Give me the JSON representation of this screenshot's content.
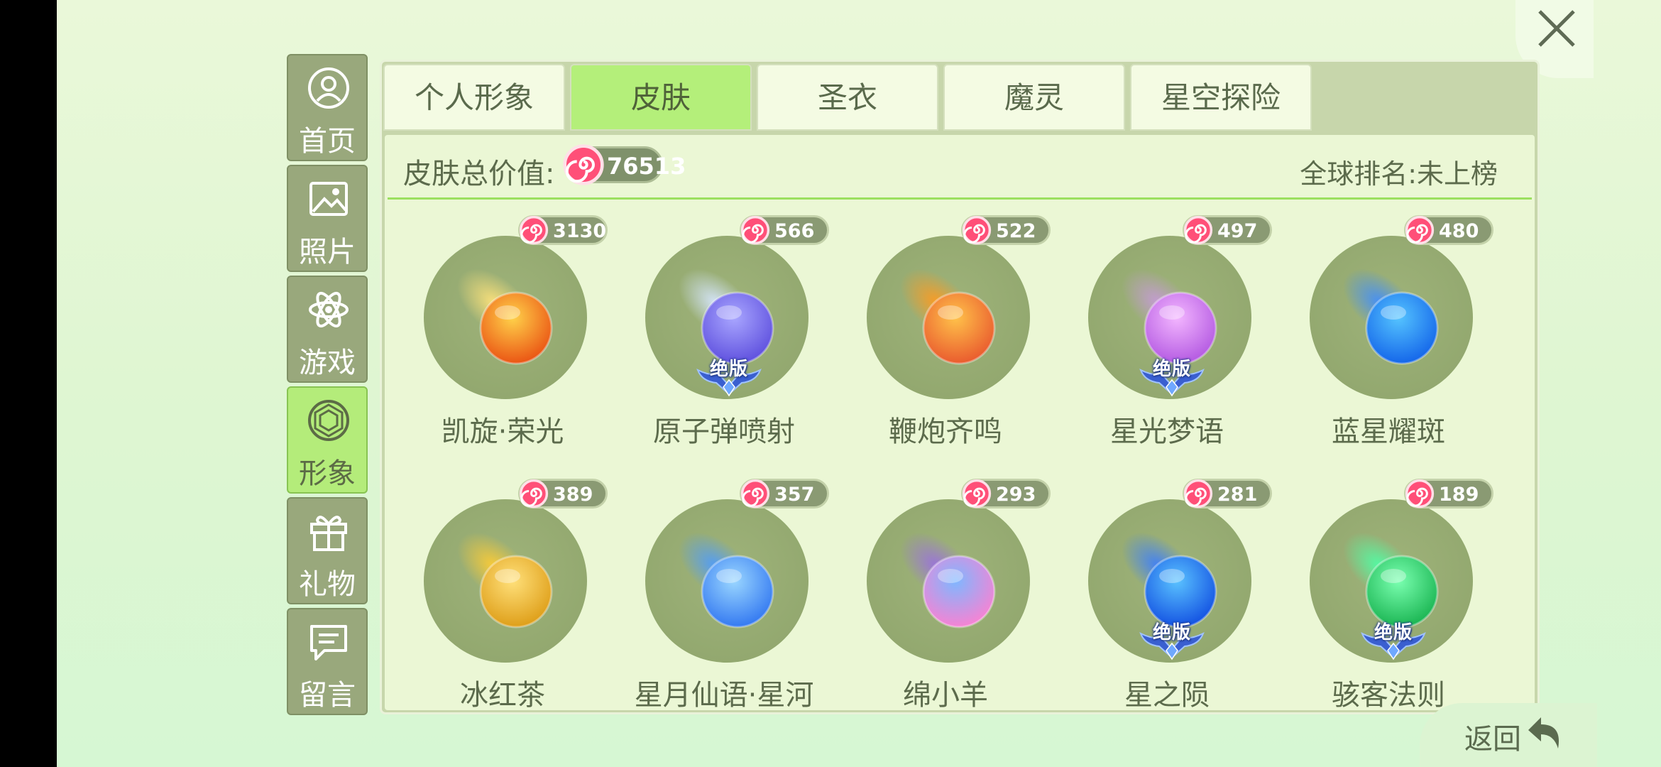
{
  "close_label": "close",
  "sidebar": {
    "items": [
      {
        "label": "首页",
        "icon": "user-icon"
      },
      {
        "label": "照片",
        "icon": "photo-icon"
      },
      {
        "label": "游戏",
        "icon": "atom-icon"
      },
      {
        "label": "形象",
        "icon": "gem-icon",
        "active": true
      },
      {
        "label": "礼物",
        "icon": "gift-icon"
      },
      {
        "label": "留言",
        "icon": "message-icon"
      }
    ]
  },
  "tabs": [
    {
      "label": "个人形象"
    },
    {
      "label": "皮肤",
      "active": true
    },
    {
      "label": "圣衣"
    },
    {
      "label": "魔灵"
    },
    {
      "label": "星空探险"
    }
  ],
  "summary": {
    "label": "皮肤总价值:",
    "value": "76513",
    "rank": "全球排名:未上榜"
  },
  "limited_label": "绝版",
  "skins": [
    {
      "name": "凯旋·荣光",
      "price": "3130",
      "limited": false,
      "colors": [
        "#ffd24a",
        "#e94c10"
      ],
      "trail": "#ffe27a"
    },
    {
      "name": "原子弹喷射",
      "price": "566",
      "limited": true,
      "colors": [
        "#a9a6ff",
        "#5a4bdc"
      ],
      "trail": "#d6e6ff"
    },
    {
      "name": "鞭炮齐鸣",
      "price": "522",
      "limited": false,
      "colors": [
        "#ffc24a",
        "#e8542c"
      ],
      "trail": "#ff9a1f"
    },
    {
      "name": "星光梦语",
      "price": "497",
      "limited": true,
      "colors": [
        "#f3b6ff",
        "#b054e0"
      ],
      "trail": "#c69ad8"
    },
    {
      "name": "蓝星耀斑",
      "price": "480",
      "limited": false,
      "colors": [
        "#55c4ff",
        "#1060e8"
      ],
      "trail": "#3f8dff"
    },
    {
      "name": "冰红茶",
      "price": "389",
      "limited": false,
      "colors": [
        "#ffe07a",
        "#dc9a12"
      ],
      "trail": "#ffcc33"
    },
    {
      "name": "星月仙语·星河",
      "price": "357",
      "limited": false,
      "colors": [
        "#9ad6ff",
        "#2d73f0"
      ],
      "trail": "#4d9bff"
    },
    {
      "name": "绵小羊",
      "price": "293",
      "limited": false,
      "colors": [
        "#7fb7ff",
        "#ff7fd0"
      ],
      "trail": "#9a6fe0"
    },
    {
      "name": "星之陨",
      "price": "281",
      "limited": true,
      "colors": [
        "#5ac2ff",
        "#0f4be0"
      ],
      "trail": "#3a7dff"
    },
    {
      "name": "骇客法则",
      "price": "189",
      "limited": true,
      "colors": [
        "#7affb0",
        "#14b04c"
      ],
      "trail": "#4dffa6"
    }
  ],
  "back_label": "返回"
}
